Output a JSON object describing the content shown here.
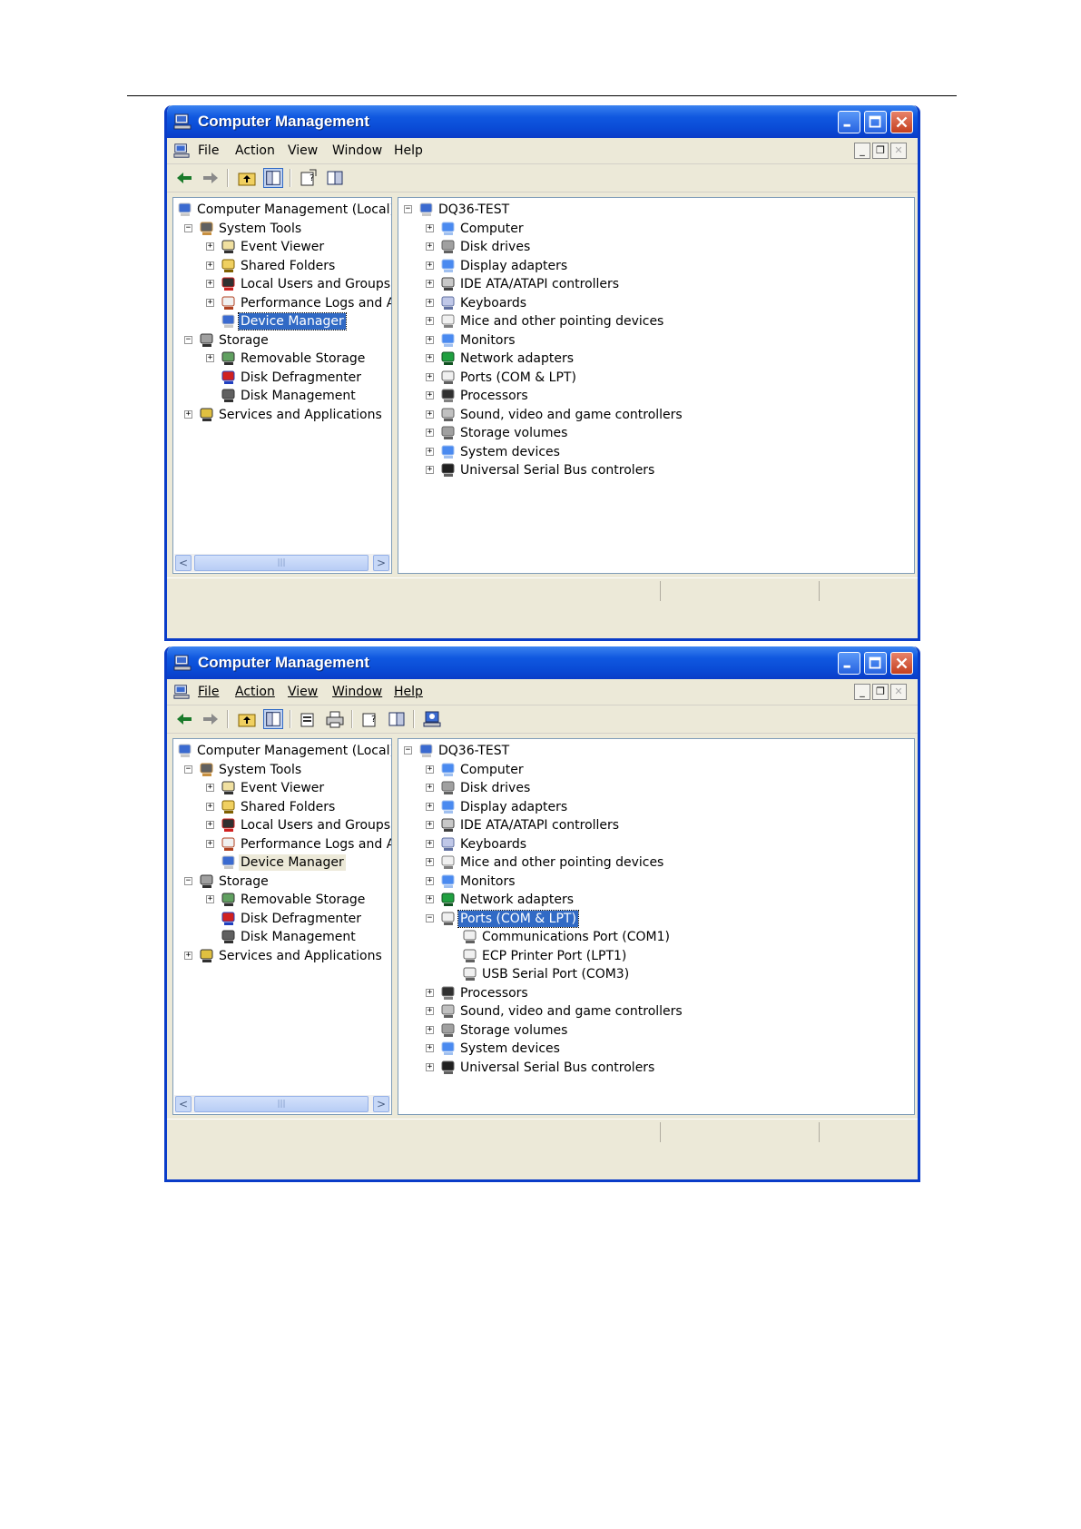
{
  "windows": [
    {
      "title": "Computer Management",
      "menu": [
        "File",
        "Action",
        "View",
        "Window",
        "Help"
      ],
      "left_tree": [
        {
          "label": "Computer Management (Local)",
          "level": 0,
          "expander": "",
          "icon": "computer-management-icon"
        },
        {
          "label": "System Tools",
          "level": 1,
          "expander": "−",
          "icon": "system-tools-icon"
        },
        {
          "label": "Event Viewer",
          "level": 2,
          "expander": "+",
          "icon": "event-viewer-icon"
        },
        {
          "label": "Shared Folders",
          "level": 2,
          "expander": "+",
          "icon": "shared-folders-icon"
        },
        {
          "label": "Local Users and Groups",
          "level": 2,
          "expander": "+",
          "icon": "users-icon"
        },
        {
          "label": "Performance Logs and Alerts",
          "level": 2,
          "expander": "+",
          "icon": "performance-icon"
        },
        {
          "label": "Device Manager",
          "level": 2,
          "expander": "",
          "icon": "device-manager-icon",
          "state": "selected"
        },
        {
          "label": "Storage",
          "level": 1,
          "expander": "−",
          "icon": "storage-icon"
        },
        {
          "label": "Removable Storage",
          "level": 2,
          "expander": "+",
          "icon": "removable-storage-icon"
        },
        {
          "label": "Disk Defragmenter",
          "level": 2,
          "expander": "",
          "icon": "defrag-icon"
        },
        {
          "label": "Disk Management",
          "level": 2,
          "expander": "",
          "icon": "disk-management-icon"
        },
        {
          "label": "Services and Applications",
          "level": 1,
          "expander": "+",
          "icon": "services-icon"
        }
      ],
      "right_tree": [
        {
          "label": "DQ36-TEST",
          "level": 0,
          "expander": "−",
          "icon": "computer-icon"
        },
        {
          "label": "Computer",
          "level": 1,
          "expander": "+",
          "icon": "computer-node-icon"
        },
        {
          "label": "Disk drives",
          "level": 1,
          "expander": "+",
          "icon": "disk-drive-icon"
        },
        {
          "label": "Display adapters",
          "level": 1,
          "expander": "+",
          "icon": "display-adapter-icon"
        },
        {
          "label": "IDE ATA/ATAPI controllers",
          "level": 1,
          "expander": "+",
          "icon": "ide-controller-icon"
        },
        {
          "label": "Keyboards",
          "level": 1,
          "expander": "+",
          "icon": "keyboard-icon"
        },
        {
          "label": "Mice and other pointing devices",
          "level": 1,
          "expander": "+",
          "icon": "mouse-icon"
        },
        {
          "label": "Monitors",
          "level": 1,
          "expander": "+",
          "icon": "monitor-icon"
        },
        {
          "label": "Network adapters",
          "level": 1,
          "expander": "+",
          "icon": "network-adapter-icon"
        },
        {
          "label": "Ports (COM & LPT)",
          "level": 1,
          "expander": "+",
          "icon": "port-icon"
        },
        {
          "label": "Processors",
          "level": 1,
          "expander": "+",
          "icon": "processor-icon"
        },
        {
          "label": "Sound, video and game controllers",
          "level": 1,
          "expander": "+",
          "icon": "sound-icon"
        },
        {
          "label": "Storage volumes",
          "level": 1,
          "expander": "+",
          "icon": "storage-volume-icon"
        },
        {
          "label": "System devices",
          "level": 1,
          "expander": "+",
          "icon": "system-device-icon"
        },
        {
          "label": "Universal Serial Bus controlers",
          "level": 1,
          "expander": "+",
          "icon": "usb-icon"
        }
      ]
    },
    {
      "title": "Computer Management",
      "menu": [
        "File",
        "Action",
        "View",
        "Window",
        "Help"
      ],
      "left_tree": [
        {
          "label": "Computer Management (Local)",
          "level": 0,
          "expander": "",
          "icon": "computer-management-icon"
        },
        {
          "label": "System Tools",
          "level": 1,
          "expander": "−",
          "icon": "system-tools-icon"
        },
        {
          "label": "Event Viewer",
          "level": 2,
          "expander": "+",
          "icon": "event-viewer-icon"
        },
        {
          "label": "Shared Folders",
          "level": 2,
          "expander": "+",
          "icon": "shared-folders-icon"
        },
        {
          "label": "Local Users and Groups",
          "level": 2,
          "expander": "+",
          "icon": "users-icon"
        },
        {
          "label": "Performance Logs and Alerts",
          "level": 2,
          "expander": "+",
          "icon": "performance-icon"
        },
        {
          "label": "Device Manager",
          "level": 2,
          "expander": "",
          "icon": "device-manager-icon",
          "state": "highlighted"
        },
        {
          "label": "Storage",
          "level": 1,
          "expander": "−",
          "icon": "storage-icon"
        },
        {
          "label": "Removable Storage",
          "level": 2,
          "expander": "+",
          "icon": "removable-storage-icon"
        },
        {
          "label": "Disk Defragmenter",
          "level": 2,
          "expander": "",
          "icon": "defrag-icon"
        },
        {
          "label": "Disk Management",
          "level": 2,
          "expander": "",
          "icon": "disk-management-icon"
        },
        {
          "label": "Services and Applications",
          "level": 1,
          "expander": "+",
          "icon": "services-icon"
        }
      ],
      "right_tree": [
        {
          "label": "DQ36-TEST",
          "level": 0,
          "expander": "−",
          "icon": "computer-icon"
        },
        {
          "label": "Computer",
          "level": 1,
          "expander": "+",
          "icon": "computer-node-icon"
        },
        {
          "label": "Disk drives",
          "level": 1,
          "expander": "+",
          "icon": "disk-drive-icon"
        },
        {
          "label": "Display adapters",
          "level": 1,
          "expander": "+",
          "icon": "display-adapter-icon"
        },
        {
          "label": "IDE ATA/ATAPI controllers",
          "level": 1,
          "expander": "+",
          "icon": "ide-controller-icon"
        },
        {
          "label": "Keyboards",
          "level": 1,
          "expander": "+",
          "icon": "keyboard-icon"
        },
        {
          "label": "Mice and other pointing devices",
          "level": 1,
          "expander": "+",
          "icon": "mouse-icon"
        },
        {
          "label": "Monitors",
          "level": 1,
          "expander": "+",
          "icon": "monitor-icon"
        },
        {
          "label": "Network adapters",
          "level": 1,
          "expander": "+",
          "icon": "network-adapter-icon"
        },
        {
          "label": "Ports (COM & LPT)",
          "level": 1,
          "expander": "−",
          "icon": "port-icon",
          "state": "selected"
        },
        {
          "label": "Communications Port (COM1)",
          "level": 2,
          "expander": "",
          "icon": "port-icon"
        },
        {
          "label": "ECP Printer Port (LPT1)",
          "level": 2,
          "expander": "",
          "icon": "port-icon"
        },
        {
          "label": "USB Serial Port (COM3)",
          "level": 2,
          "expander": "",
          "icon": "port-icon"
        },
        {
          "label": "Processors",
          "level": 1,
          "expander": "+",
          "icon": "processor-icon"
        },
        {
          "label": "Sound, video and game controllers",
          "level": 1,
          "expander": "+",
          "icon": "sound-icon"
        },
        {
          "label": "Storage volumes",
          "level": 1,
          "expander": "+",
          "icon": "storage-volume-icon"
        },
        {
          "label": "System devices",
          "level": 1,
          "expander": "+",
          "icon": "system-device-icon"
        },
        {
          "label": "Universal Serial Bus controlers",
          "level": 1,
          "expander": "+",
          "icon": "usb-icon"
        }
      ]
    }
  ],
  "toolbar_icons_window1": [
    "back-arrow-icon",
    "forward-arrow-icon",
    "up-folder-icon",
    "show-hide-tree-icon",
    "properties-icon",
    "help-icon"
  ],
  "toolbar_icons_window2": [
    "back-arrow-icon",
    "forward-arrow-icon",
    "up-folder-icon",
    "show-hide-tree-icon",
    "properties-icon",
    "print-icon",
    "help-icon",
    "show-hide-tree-icon",
    "scan-hardware-icon"
  ],
  "colors": {
    "titlebar": "#0a4bd6",
    "selection": "#316ac5",
    "chrome": "#ece9d8"
  }
}
